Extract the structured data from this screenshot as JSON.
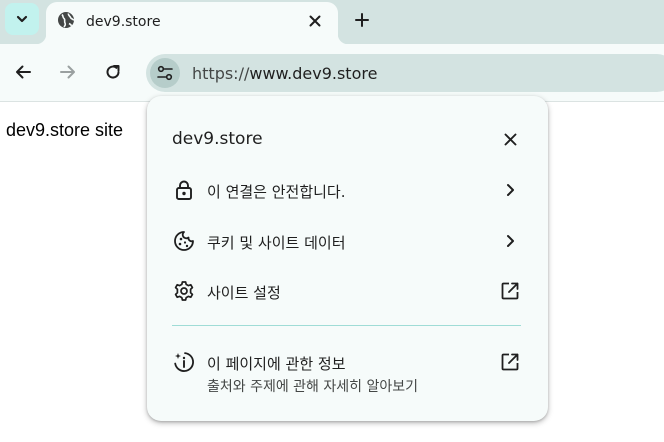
{
  "tab": {
    "title": "dev9.store",
    "favicon": "globe-icon"
  },
  "toolbar": {
    "url_scheme": "https://",
    "url_host": "www.dev9.store"
  },
  "page": {
    "text": "dev9.store site"
  },
  "popup": {
    "title": "dev9.store",
    "items": [
      {
        "label": "이 연결은 안전합니다.",
        "icon": "lock-icon",
        "trailing": "chevron-right-icon"
      },
      {
        "label": "쿠키 및 사이트 데이터",
        "icon": "cookie-icon",
        "trailing": "chevron-right-icon"
      },
      {
        "label": "사이트 설정",
        "icon": "gear-icon",
        "trailing": "open-external-icon"
      }
    ],
    "about": {
      "label": "이 페이지에 관한 정보",
      "sublabel": "출처와 주제에 관해 자세히 알아보기",
      "icon": "page-info-sparkle-icon",
      "trailing": "open-external-icon"
    }
  },
  "colors": {
    "tabstrip_bg": "#d3e3e1",
    "toolbar_bg": "#f6fbfa",
    "omnibox_bg": "#d3e3e1",
    "tab_search_bg": "#c2f2ee",
    "divider": "#9fdcd6"
  }
}
